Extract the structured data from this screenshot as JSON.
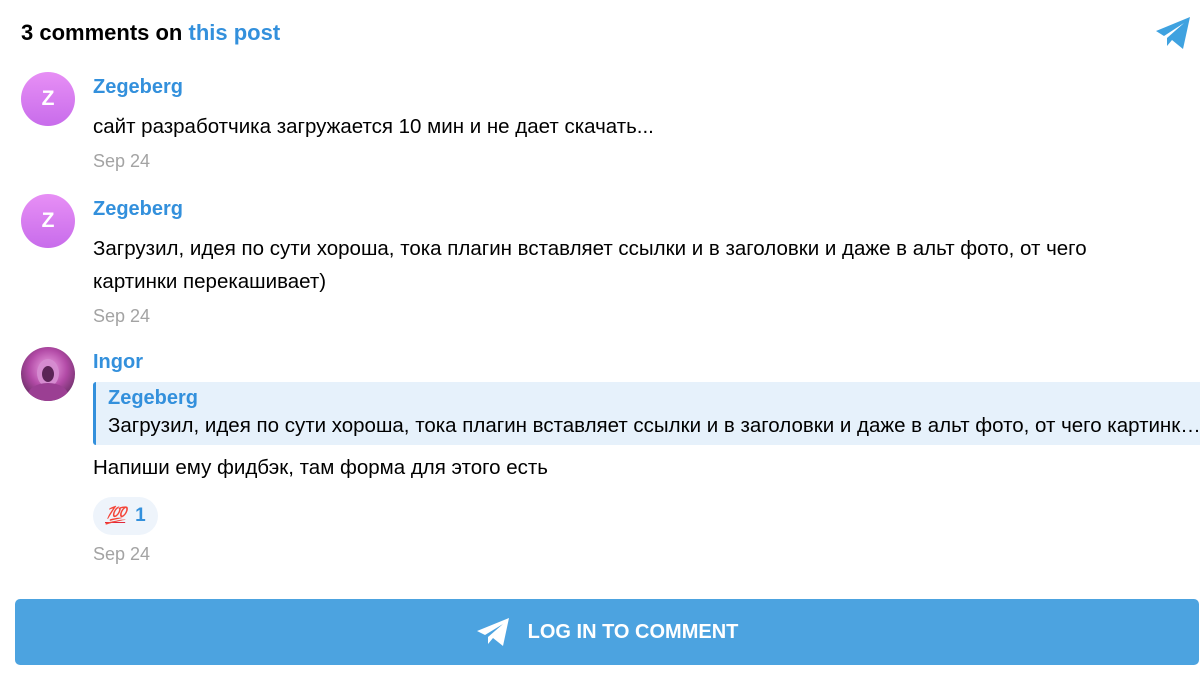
{
  "header": {
    "count_text": "3 comments on",
    "link_text": "this post"
  },
  "comments": [
    {
      "avatar_letter": "Z",
      "author": "Zegeberg",
      "text": "сайт разработчика загружается 10 мин и не дает скачать...",
      "date": "Sep 24"
    },
    {
      "avatar_letter": "Z",
      "author": "Zegeberg",
      "text": "Загрузил, идея по сути хороша, тока плагин вставляет ссылки и в заголовки и даже в альт фото, от чего картинки перекашивает)",
      "date": "Sep 24"
    },
    {
      "author": "Ingor",
      "reply": {
        "author": "Zegeberg",
        "text": "Загрузил, идея по сути хороша, тока плагин вставляет ссылки и в заголовки и даже в альт фото, от чего картинки перекашивает)"
      },
      "text": "Напиши ему фидбэк, там форма для этого есть",
      "reaction": {
        "emoji": "💯",
        "count": "1"
      },
      "date": "Sep 24"
    }
  ],
  "login_button": {
    "label": "LOG IN TO COMMENT"
  },
  "colors": {
    "accent": "#3390dc",
    "button": "#4ca3e0",
    "date": "#a3a3a3"
  }
}
